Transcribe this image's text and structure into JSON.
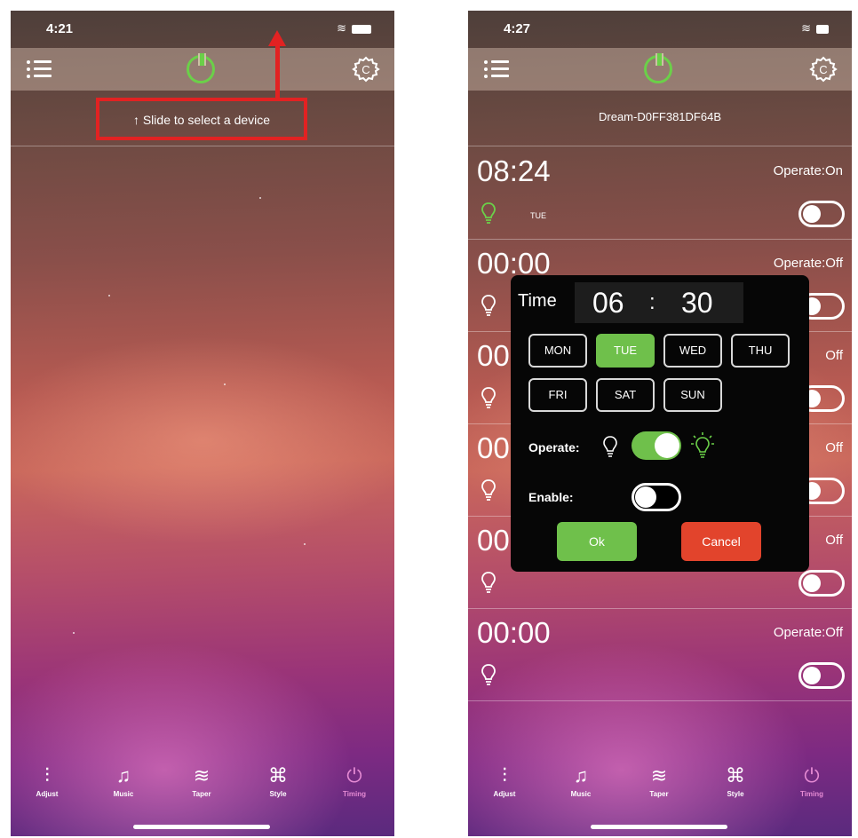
{
  "left_screen": {
    "status_time": "4:21",
    "slide_hint": "↑ Slide to select a device"
  },
  "right_screen": {
    "status_time": "4:27",
    "device_name": "Dream-D0FF381DF64B",
    "timers": [
      {
        "time": "08:24",
        "operate": "Operate:On",
        "day": "TUE",
        "bulb_color": "#6bd049"
      },
      {
        "time": "00:00",
        "operate": "Operate:Off",
        "day": "",
        "bulb_color": "#ffffff"
      },
      {
        "time": "00",
        "operate": "Off",
        "day": "",
        "bulb_color": "#ffffff"
      },
      {
        "time": "00",
        "operate": "Off",
        "day": "",
        "bulb_color": "#ffffff"
      },
      {
        "time": "00",
        "operate": "Off",
        "day": "",
        "bulb_color": "#ffffff"
      },
      {
        "time": "00:00",
        "operate": "Operate:Off",
        "day": "",
        "bulb_color": "#ffffff"
      }
    ],
    "dialog": {
      "time_label": "Time",
      "hour": "06",
      "separator": ":",
      "minute": "30",
      "days": [
        "MON",
        "TUE",
        "WED",
        "THU",
        "FRI",
        "SAT",
        "SUN"
      ],
      "selected_day": "TUE",
      "operate_label": "Operate:",
      "operate_on": true,
      "enable_label": "Enable:",
      "enable_on": false,
      "ok_label": "Ok",
      "cancel_label": "Cancel"
    }
  },
  "tabs": [
    {
      "label": "Adjust",
      "icon": "sliders-icon"
    },
    {
      "label": "Music",
      "icon": "music-note-icon"
    },
    {
      "label": "Taper",
      "icon": "wave-icon"
    },
    {
      "label": "Style",
      "icon": "command-icon"
    },
    {
      "label": "Timing",
      "icon": "timer-icon"
    }
  ],
  "active_tab": "Timing",
  "colors": {
    "accent_green": "#6fc04b",
    "power_green": "#6bd049",
    "cancel_red": "#e2442c",
    "annotation_red": "#e22222",
    "active_tab_pink": "#e58ad3"
  }
}
